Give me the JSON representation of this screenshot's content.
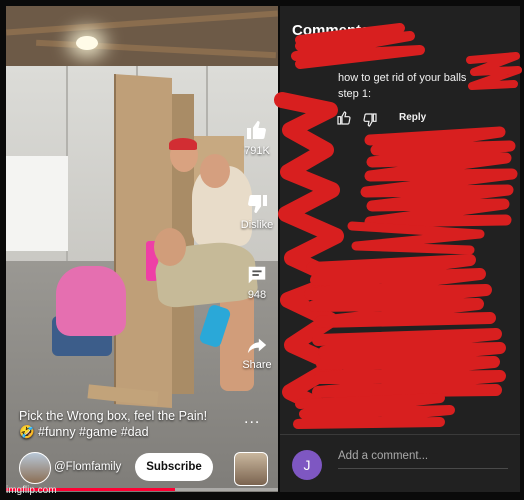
{
  "video": {
    "like_count": "791K",
    "dislike_label": "Dislike",
    "comment_count": "948",
    "share_label": "Share",
    "more_label": "...",
    "caption": "Pick the Wrong box, feel the Pain! 🤣 #funny #game #dad",
    "channel": "@Flomfamily",
    "subscribe_label": "Subscribe",
    "progress_fraction": 0.62
  },
  "comments": {
    "title": "Comments",
    "count": "948",
    "top_comment": {
      "line1": "how to get rid of your balls",
      "line2": "step 1:"
    },
    "reply_label": "Reply",
    "add_comment_avatar_letter": "J",
    "add_comment_placeholder": "Add a comment..."
  },
  "watermark": "imgflip.com",
  "colors": {
    "scribble_red": "#d81f1f",
    "panel_bg": "#212121",
    "subscribe_bg": "#ffffff",
    "progress_red": "#ff0033",
    "avatar_purple": "#7e57c2"
  },
  "icons": [
    "like-icon",
    "dislike-icon",
    "comment-icon",
    "share-icon",
    "thumb-up-icon",
    "thumb-down-icon"
  ]
}
